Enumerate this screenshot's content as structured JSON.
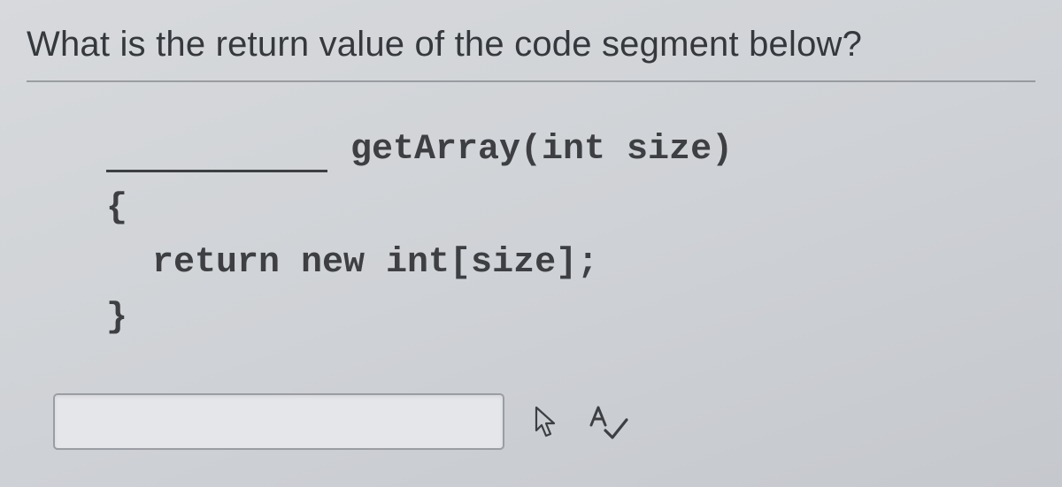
{
  "question": "What is the return value of the code segment below?",
  "code": {
    "signature_suffix": "getArray(int size)",
    "open_brace": "{",
    "return_line": "return new int[size];",
    "close_brace": "}"
  },
  "answer": {
    "value": "",
    "placeholder": ""
  }
}
